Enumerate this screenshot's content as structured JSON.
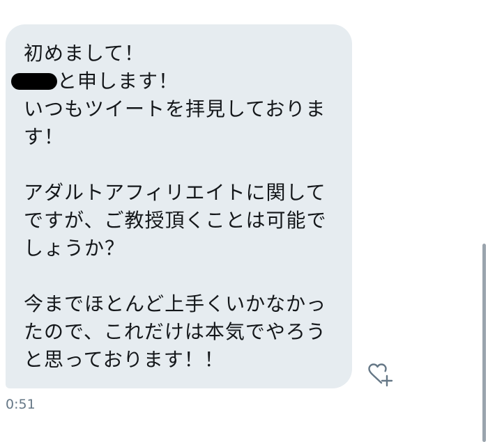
{
  "message": {
    "lines": [
      "初めまして！",
      "と申します！",
      "いつもツイートを拝見しておりま",
      "す！",
      "",
      "アダルトアフィリエイトに関して",
      "ですが、ご教授頂くことは可能で",
      "しょうか？",
      "",
      "今までほとんど上手くいかなかっ",
      "たので、これだけは本気でやろう",
      "と思っております！！"
    ],
    "timestamp": "0:51"
  },
  "icons": {
    "like": "heart-plus-icon"
  },
  "colors": {
    "bubble_bg": "#e6ecf0",
    "text": "#14171a",
    "timestamp": "#657786",
    "icon": "#657786"
  }
}
